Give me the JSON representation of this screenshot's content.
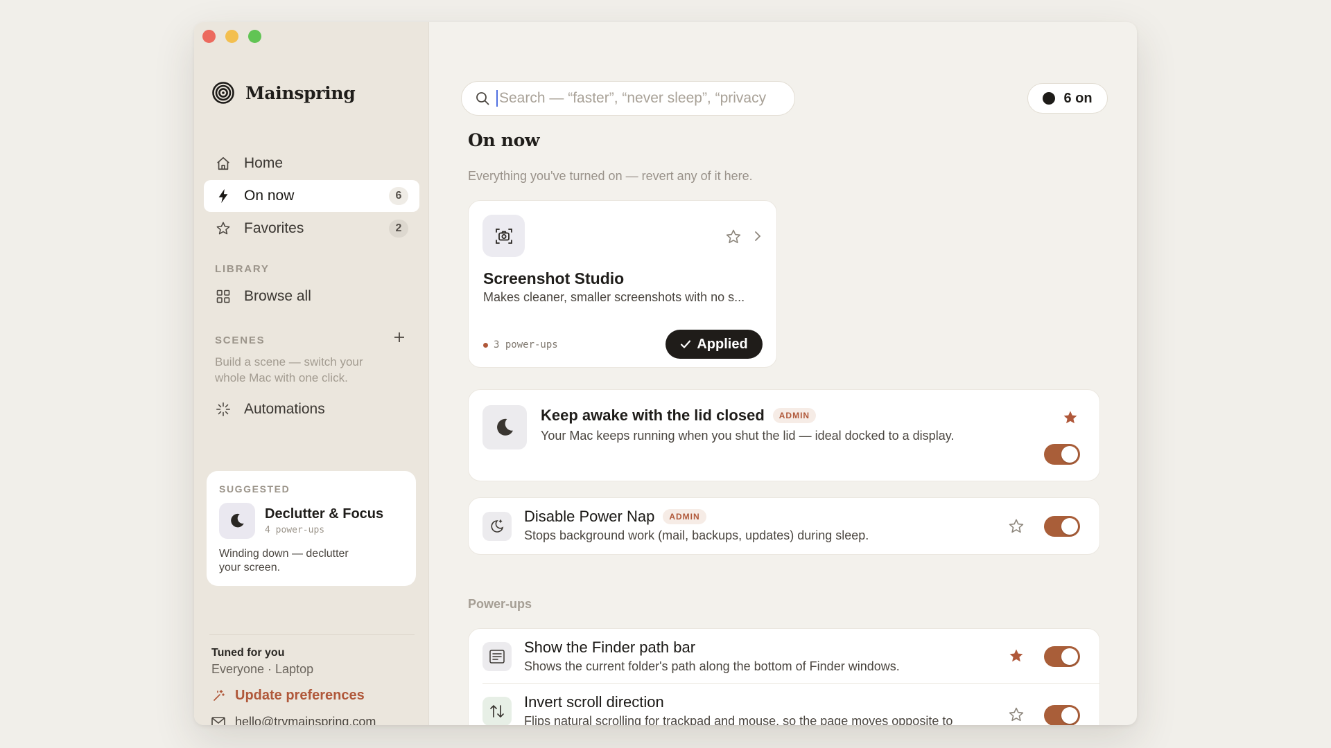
{
  "app": {
    "name": "Mainspring"
  },
  "nav": [
    {
      "label": "Home",
      "icon": "home-icon",
      "count": null
    },
    {
      "label": "On now",
      "icon": "bolt-icon",
      "count": "6"
    },
    {
      "label": "Favorites",
      "icon": "star-icon",
      "count": "2"
    }
  ],
  "library": {
    "label": "LIBRARY",
    "browse_all": "Browse all"
  },
  "scenes": {
    "label": "SCENES",
    "hint": "Build a scene — switch your whole Mac with one click.",
    "automations": "Automations"
  },
  "suggested": {
    "label": "SUGGESTED",
    "title": "Declutter & Focus",
    "meta": "4 power-ups",
    "description": "Winding down — declutter your screen."
  },
  "profile": {
    "title": "Tuned for you",
    "subtitle": "Everyone · Laptop",
    "update_label": "Update preferences",
    "email": "hello@trymainspring.com"
  },
  "search": {
    "placeholder": "Search — “faster”, “never sleep”, “privacy"
  },
  "status_pill": {
    "label": "6 on"
  },
  "page": {
    "title": "On now",
    "subtitle": "Everything you've turned on — revert any of it here."
  },
  "featured": {
    "title": "Screenshot Studio",
    "description": "Makes cleaner, smaller screenshots with no s...",
    "meta": "3 power-ups",
    "button": "Applied",
    "favorited": false
  },
  "on_items": [
    {
      "title": "Keep awake with the lid closed",
      "badge": "ADMIN",
      "description": "Your Mac keeps running when you shut the lid — ideal docked to a display.",
      "favorited": true,
      "enabled": true
    },
    {
      "title": "Disable Power Nap",
      "badge": "ADMIN",
      "description": "Stops background work (mail, backups, updates) during sleep.",
      "favorited": false,
      "enabled": true
    }
  ],
  "powerups": {
    "label": "Power-ups",
    "items": [
      {
        "title": "Show the Finder path bar",
        "description": "Shows the current folder's path along the bottom of Finder windows.",
        "favorited": true,
        "enabled": true
      },
      {
        "title": "Invert scroll direction",
        "description": "Flips natural scrolling for trackpad and mouse, so the page moves opposite to your swipe.",
        "favorited": false,
        "enabled": true
      }
    ]
  },
  "colors": {
    "accent": "#b0583a",
    "toggle_on": "#a95e39",
    "dark": "#1f1c19"
  }
}
